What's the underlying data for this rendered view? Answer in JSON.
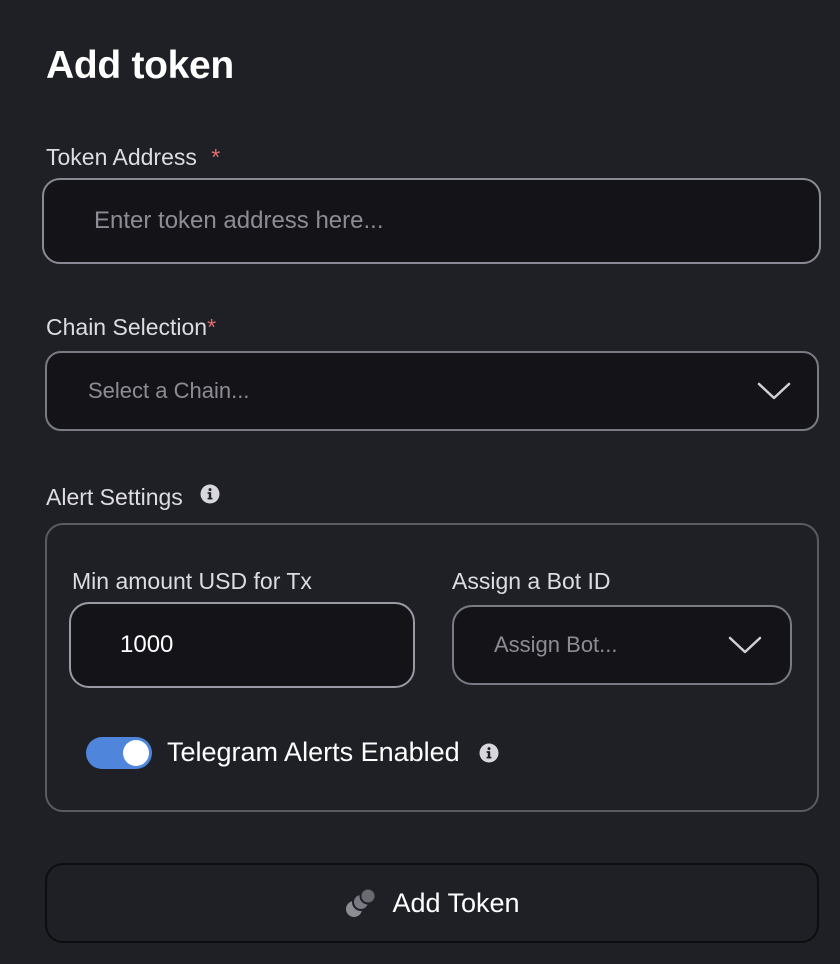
{
  "page": {
    "title": "Add token"
  },
  "token_address": {
    "label": "Token Address",
    "required_marker": "*",
    "placeholder": "Enter token address here...",
    "value": ""
  },
  "chain_selection": {
    "label": "Chain Selection",
    "required_marker": "*",
    "selected": "Select a Chain...",
    "icon": "chevron-down-icon"
  },
  "alert_settings": {
    "label": "Alert Settings",
    "info_icon": "info-icon",
    "min_amount": {
      "label": "Min amount USD for Tx",
      "value": "1000"
    },
    "bot_id": {
      "label": "Assign a Bot ID",
      "selected": "Assign Bot...",
      "icon": "chevron-down-icon"
    },
    "telegram": {
      "label": "Telegram Alerts Enabled",
      "enabled": true,
      "info_icon": "info-icon"
    }
  },
  "submit": {
    "label": "Add Token",
    "icon": "coins-icon"
  },
  "colors": {
    "background": "#1f2025",
    "field_background": "#141418",
    "required": "#e06c6c",
    "toggle_on": "#4f86dc",
    "placeholder": "#8c8c95"
  }
}
